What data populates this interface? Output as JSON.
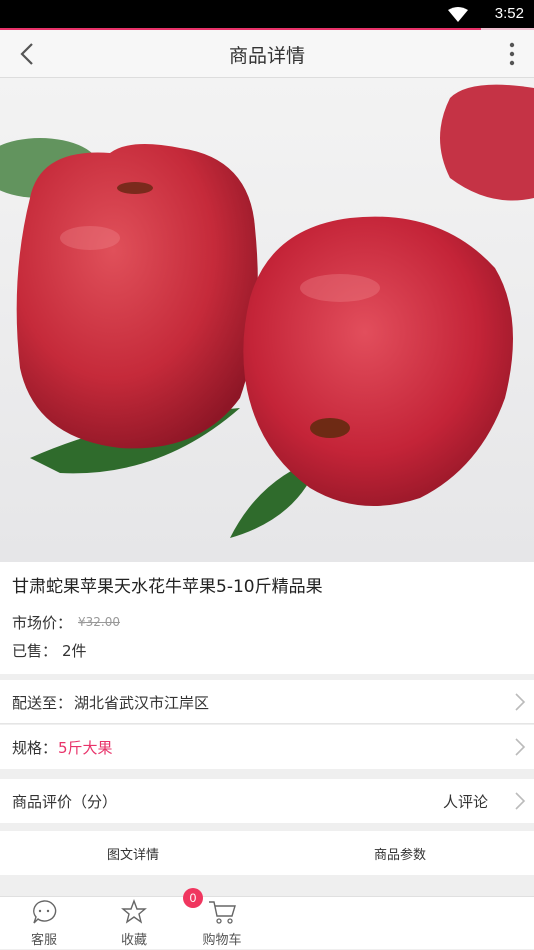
{
  "status_bar": {
    "time": "3:52",
    "icons": [
      "wifi-icon"
    ]
  },
  "page_progress": 0.9,
  "header": {
    "title": "商品详情",
    "back_icon": "back-chevron-icon",
    "menu_icon": "more-vert-icon"
  },
  "product": {
    "name": "甘肃蛇果苹果天水花牛苹果5-10斤精品果",
    "market_price_label": "市场价：",
    "market_price": "¥32.00",
    "sold_label": "已售：",
    "sold_value": "2件"
  },
  "delivery": {
    "label": "配送至：",
    "value": "湖北省武汉市江岸区"
  },
  "spec": {
    "label": "规格：",
    "value": "5斤大果"
  },
  "reviews": {
    "label": "商品评价（分）",
    "value": "人评论"
  },
  "tabs": [
    "图文详情",
    "商品参数"
  ],
  "bottom_bar": {
    "service": "客服",
    "favorite": "收藏",
    "cart": "购物车",
    "cart_count": "0"
  },
  "colors": {
    "accent": "#f0365f",
    "spec_value": "#e8336a"
  }
}
